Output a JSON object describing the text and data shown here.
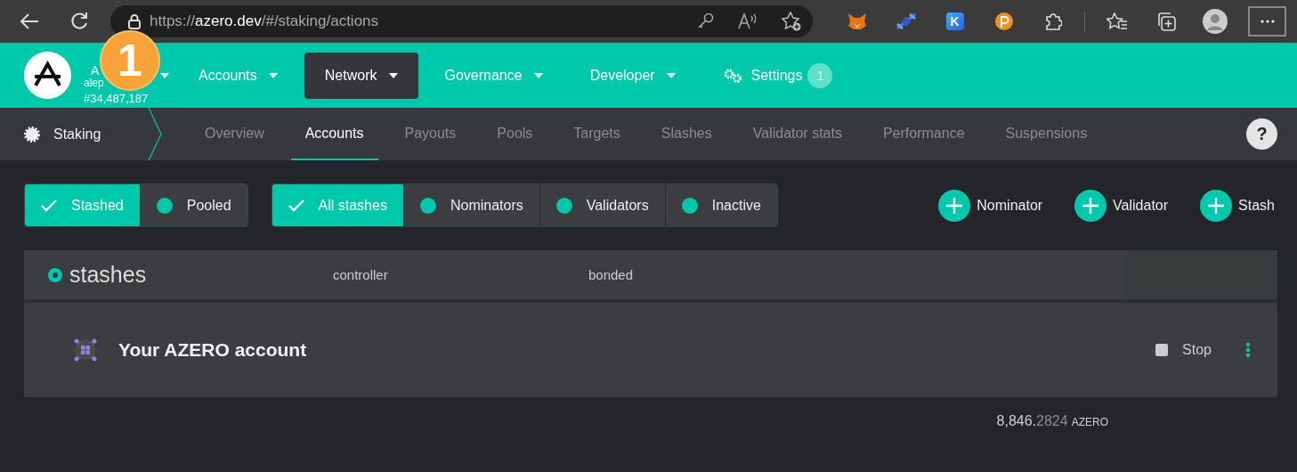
{
  "browser": {
    "url_scheme": "https://",
    "url_host": "azero.dev",
    "url_path": "/#/staking/actions",
    "extension_letter": "K"
  },
  "header": {
    "chain_name": "A",
    "node_name": "alep",
    "block": "#34,487,187",
    "annotation": "1",
    "menus": [
      {
        "label": "Accounts",
        "kind": "dropdown",
        "selected": false
      },
      {
        "label": "Network",
        "kind": "dropdown",
        "selected": true
      },
      {
        "label": "Governance",
        "kind": "dropdown",
        "selected": false
      },
      {
        "label": "Developer",
        "kind": "dropdown",
        "selected": false
      },
      {
        "label": "Settings",
        "kind": "settings",
        "selected": false,
        "badge": "1"
      }
    ]
  },
  "subnav": {
    "title": "Staking",
    "help": "?",
    "tabs": [
      {
        "label": "Overview",
        "selected": false
      },
      {
        "label": "Accounts",
        "selected": true
      },
      {
        "label": "Payouts",
        "selected": false
      },
      {
        "label": "Pools",
        "selected": false
      },
      {
        "label": "Targets",
        "selected": false
      },
      {
        "label": "Slashes",
        "selected": false
      },
      {
        "label": "Validator stats",
        "selected": false
      },
      {
        "label": "Performance",
        "selected": false
      },
      {
        "label": "Suspensions",
        "selected": false
      }
    ]
  },
  "filters": {
    "groups": [
      {
        "items": [
          {
            "label": "Stashed",
            "selected": true
          },
          {
            "label": "Pooled",
            "selected": false
          }
        ]
      },
      {
        "items": [
          {
            "label": "All stashes",
            "selected": true
          },
          {
            "label": "Nominators",
            "selected": false
          },
          {
            "label": "Validators",
            "selected": false
          },
          {
            "label": "Inactive",
            "selected": false
          }
        ]
      }
    ],
    "actions": [
      "Nominator",
      "Validator",
      "Stash"
    ]
  },
  "table": {
    "title": "stashes",
    "columns": [
      "controller",
      "bonded"
    ],
    "rows": [
      {
        "name": "Your AZERO account",
        "action": "Stop"
      }
    ]
  },
  "total": {
    "whole": "8,846.",
    "fraction": "2824",
    "unit": "AZERO"
  }
}
